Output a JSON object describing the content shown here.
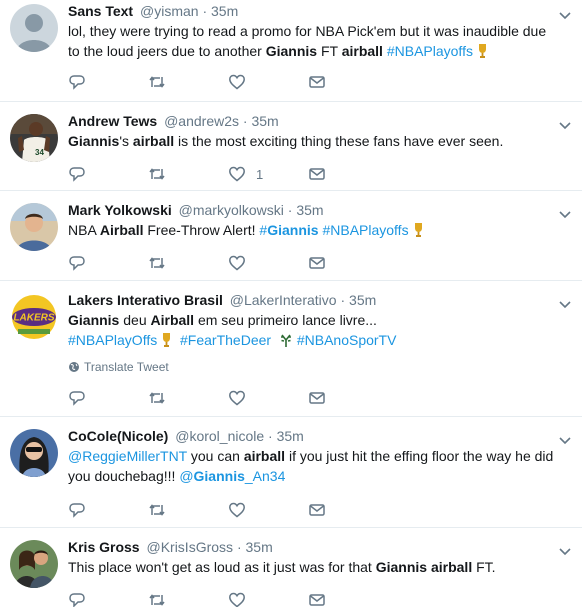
{
  "colors": {
    "link": "#1b95e0",
    "muted": "#657786",
    "text": "#14171a",
    "border": "#e6ecf0"
  },
  "tweets": [
    {
      "name": "Sans Text",
      "handle": "@yisman",
      "dot": "·",
      "time": "35m",
      "avatar": "default-avatar",
      "text": {
        "t1": "lol, they were trying to read a promo for NBA Pick'em but it was inaudible due to the loud jeers due to another ",
        "b1": "Giannis",
        "t2": " FT ",
        "b2": "airball",
        "tag1": "#NBAPlayoffs"
      },
      "likes": ""
    },
    {
      "name": "Andrew Tews",
      "handle": "@andrew2s",
      "dot": "·",
      "time": "35m",
      "avatar": "bucks-player-photo",
      "text": {
        "b1": "Giannis",
        "t1": "'s ",
        "b2": "airball",
        "t2": " is the most exciting thing these fans have ever seen."
      },
      "likes": "1"
    },
    {
      "name": "Mark Yolkowski",
      "handle": "@markyolkowski",
      "dot": "·",
      "time": "35m",
      "avatar": "man-photo",
      "text": {
        "t1": "NBA ",
        "b1": "Airball",
        "t2": " Free-Throw Alert!  ",
        "tag1": "#Giannis",
        "tag2": "#NBAPlayoffs"
      },
      "likes": ""
    },
    {
      "name": "Lakers Interativo Brasil",
      "handle": "@LakerInterativo",
      "dot": "·",
      "time": "35m",
      "avatar": "lakers-logo",
      "text": {
        "b1": "Giannis",
        "t1": " deu ",
        "b2": "Airball",
        "t2": " em seu primeiro lance livre...",
        "tag1": "#NBAPlayOffs",
        "tag2": "#FearTheDeer",
        "tag3": "#NBAnoSporTV"
      },
      "translate": "Translate Tweet",
      "likes": ""
    },
    {
      "name": "CoCole(Nicole)",
      "handle": "@korol_nicole",
      "dot": "·",
      "time": "35m",
      "avatar": "woman-photo",
      "text": {
        "m1": "@ReggieMillerTNT",
        "t1": " you can ",
        "b1": "airball",
        "t2": " if you just hit the effing floor the way he did you douchebag!!! ",
        "m2a": "@",
        "m2b": "Giannis",
        "m2c": "_An34"
      },
      "likes": ""
    },
    {
      "name": "Kris Gross",
      "handle": "@KrisIsGross",
      "dot": "·",
      "time": "35m",
      "avatar": "couple-photo",
      "text": {
        "t1": "This place won't get as loud as it just was for that ",
        "b1": "Giannis",
        "t2": " ",
        "b2": "airball",
        "t3": " FT."
      },
      "likes": ""
    }
  ]
}
